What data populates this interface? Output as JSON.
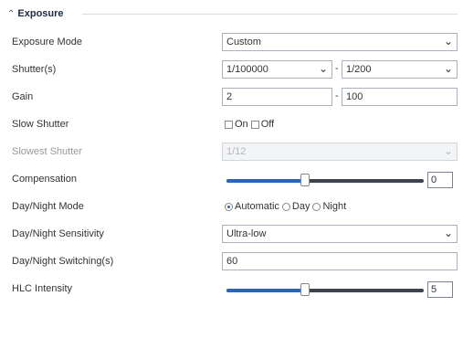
{
  "section": {
    "title": "Exposure"
  },
  "exposure_mode": {
    "label": "Exposure Mode",
    "value": "Custom"
  },
  "shutter": {
    "label": "Shutter(s)",
    "min": "1/100000",
    "separator": "-",
    "max": "1/200"
  },
  "gain": {
    "label": "Gain",
    "min": "2",
    "separator": "-",
    "max": "100"
  },
  "slow_shutter": {
    "label": "Slow Shutter",
    "options": [
      "On",
      "Off"
    ],
    "checked": "Off"
  },
  "slowest_shutter": {
    "label": "Slowest Shutter",
    "value": "1/12"
  },
  "compensation": {
    "label": "Compensation",
    "value": "0",
    "level": 0.4
  },
  "day_night_mode": {
    "label": "Day/Night Mode",
    "options": [
      "Automatic",
      "Day",
      "Night"
    ],
    "selected": "Automatic"
  },
  "day_night_sensitivity": {
    "label": "Day/Night Sensitivity",
    "value": "Ultra-low"
  },
  "day_night_switch_time": {
    "label": "Day/Night Switching(s)",
    "value": "60"
  },
  "hlc_intensity": {
    "label": "HLC Intensity",
    "value": "5",
    "level": 0.4
  },
  "colors": {
    "accent": "#2a66b8",
    "track": "#3d4450"
  }
}
